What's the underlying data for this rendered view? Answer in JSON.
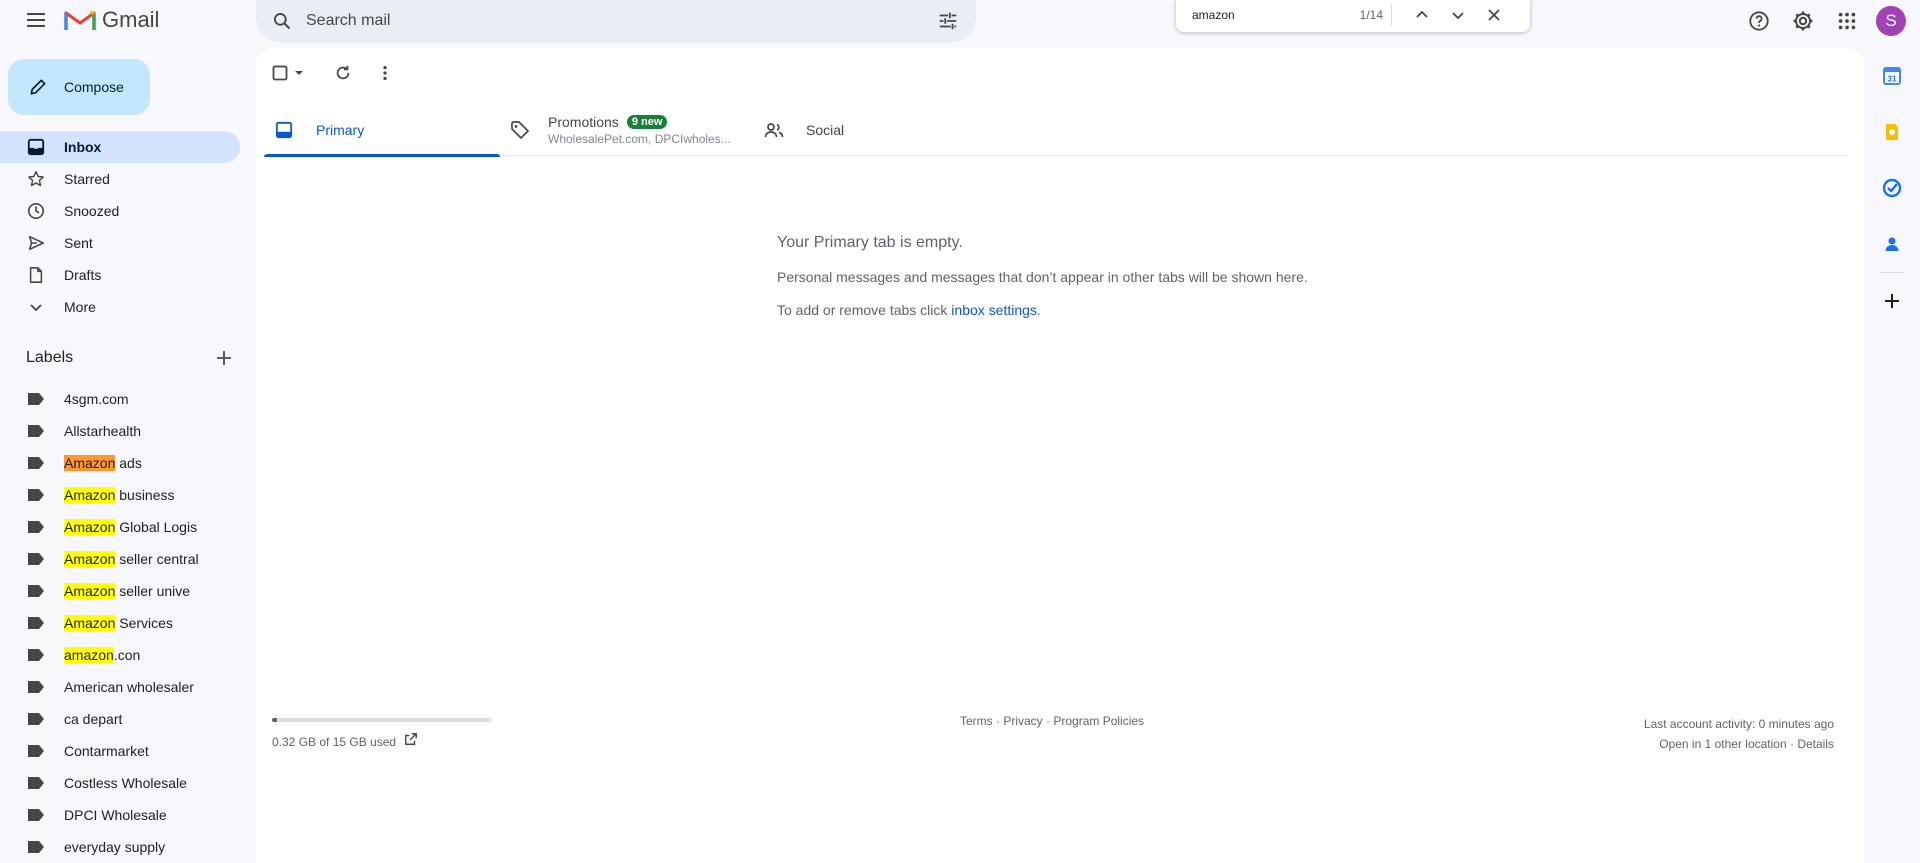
{
  "app": {
    "name": "Gmail",
    "avatar_letter": "S",
    "avatar_color": "#a142b4"
  },
  "search": {
    "placeholder": "Search mail"
  },
  "find": {
    "query": "amazon",
    "count": "1/14"
  },
  "compose": {
    "label": "Compose"
  },
  "nav": [
    {
      "label": "Inbox",
      "icon": "inbox-icon",
      "active": true
    },
    {
      "label": "Starred",
      "icon": "star-icon"
    },
    {
      "label": "Snoozed",
      "icon": "clock-icon"
    },
    {
      "label": "Sent",
      "icon": "send-icon"
    },
    {
      "label": "Drafts",
      "icon": "draft-icon"
    },
    {
      "label": "More",
      "icon": "chevron-down-icon"
    }
  ],
  "labels_title": "Labels",
  "labels": [
    {
      "match": "",
      "rest": "4sgm.com"
    },
    {
      "match": "",
      "rest": "Allstarhealth"
    },
    {
      "match": "Amazon",
      "rest": " ads",
      "current": true
    },
    {
      "match": "Amazon",
      "rest": " business"
    },
    {
      "match": "Amazon",
      "rest": " Global Logis"
    },
    {
      "match": "Amazon",
      "rest": " seller central"
    },
    {
      "match": "Amazon",
      "rest": " seller unive"
    },
    {
      "match": "Amazon",
      "rest": " Services"
    },
    {
      "match": "amazon",
      "rest": ".con"
    },
    {
      "match": "",
      "rest": "American wholesaler"
    },
    {
      "match": "",
      "rest": "ca depart"
    },
    {
      "match": "",
      "rest": "Contarmarket"
    },
    {
      "match": "",
      "rest": "Costless Wholesale"
    },
    {
      "match": "",
      "rest": "DPCI Wholesale"
    },
    {
      "match": "",
      "rest": "everyday supply"
    }
  ],
  "tabs": {
    "primary": "Primary",
    "promotions": "Promotions",
    "promotions_badge": "9 new",
    "promotions_sub": "WholesalePet.com, DPCIwholes...",
    "social": "Social"
  },
  "empty": {
    "title": "Your Primary tab is empty.",
    "line1": "Personal messages and messages that don’t appear in other tabs will be shown here.",
    "line2_prefix": "To add or remove tabs click ",
    "line2_link": "inbox settings",
    "line2_suffix": "."
  },
  "footer": {
    "storage": "0.32 GB of 15 GB used",
    "storage_fraction": 0.021,
    "terms": "Terms",
    "privacy": "Privacy",
    "policies": "Program Policies",
    "activity": "Last account activity: 0 minutes ago",
    "location": "Open in 1 other location",
    "details": "Details"
  },
  "colors": {
    "accent": "#0b57d0",
    "compose_bg": "#c2e7ff",
    "active_nav": "#d3e3fd",
    "badge": "#188038",
    "highlight": "#ffff00",
    "highlight_current": "#ff9632"
  }
}
